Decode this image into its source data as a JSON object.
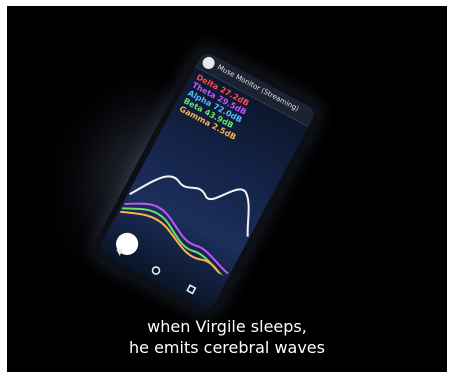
{
  "phone": {
    "app_title": "Muse Monitor (Streaming)",
    "bands": [
      {
        "label": "Delta 27.2dB",
        "color": "#ff4b4b"
      },
      {
        "label": "Theta 29.5dB",
        "color": "#c055ff"
      },
      {
        "label": "Alpha 72.0dB",
        "color": "#58b8ff"
      },
      {
        "label": "Beta 43.9dB",
        "color": "#67e36a"
      },
      {
        "label": "Gamma 2.5dB",
        "color": "#ffb24a"
      }
    ]
  },
  "subtitle": {
    "line1": "when Virgile sleeps,",
    "line2": "he emits cerebral waves"
  }
}
